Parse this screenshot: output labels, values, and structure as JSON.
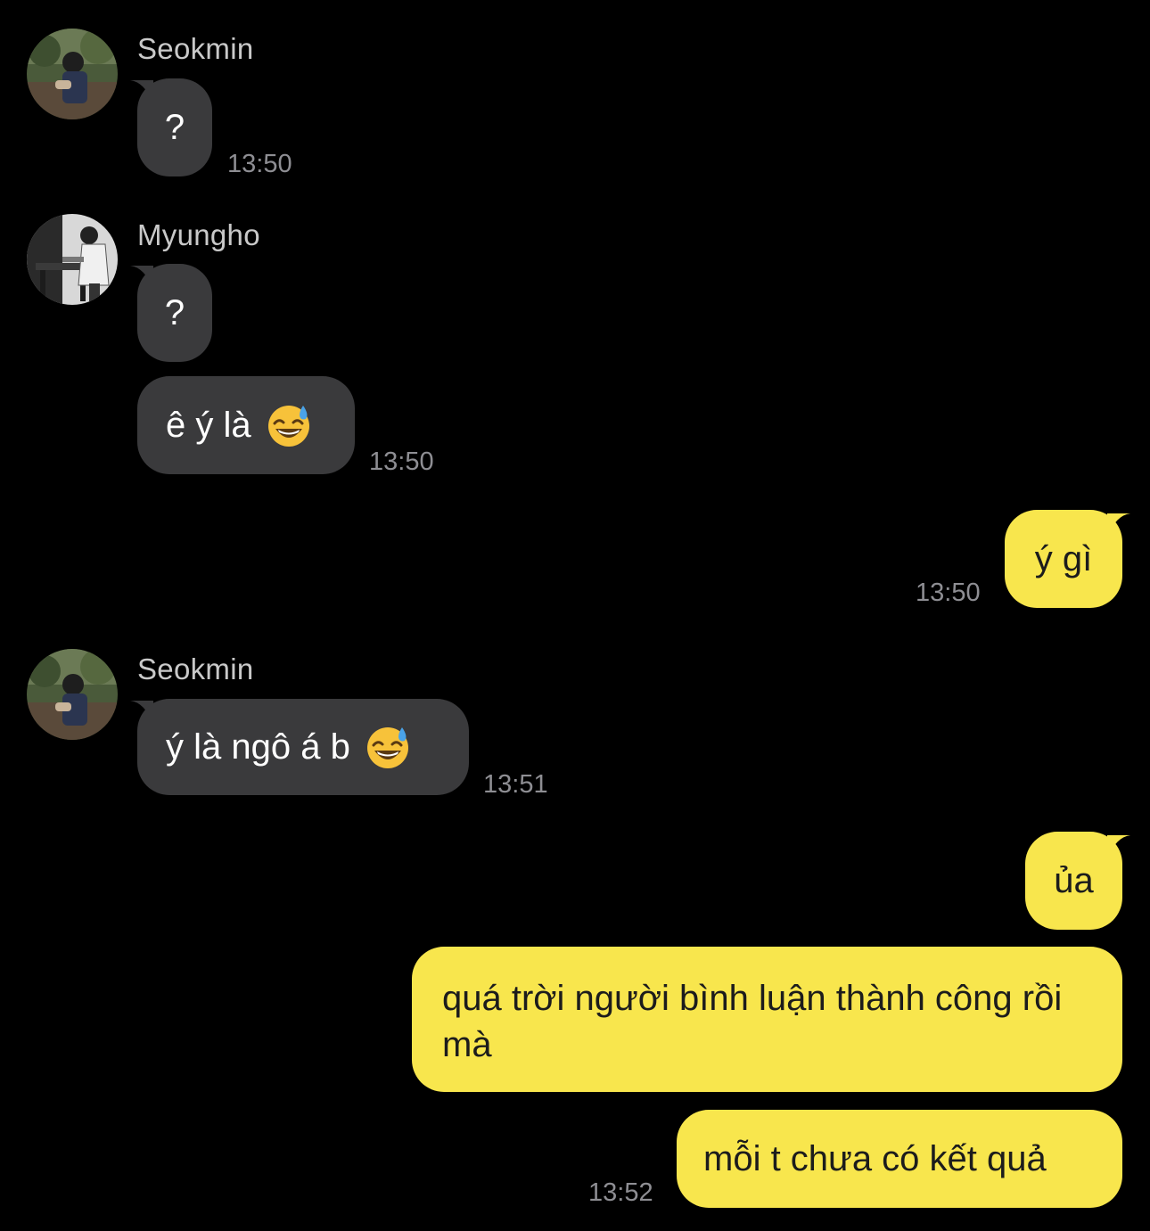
{
  "chat": {
    "groups": [
      {
        "sender": "Seokmin",
        "avatar_icon": "seokmin-avatar-photo",
        "messages": [
          {
            "text": "?",
            "time": "13:50"
          }
        ]
      },
      {
        "sender": "Myungho",
        "avatar_icon": "myungho-avatar-photo",
        "messages": [
          {
            "text": "?"
          },
          {
            "text": "ê ý là",
            "emoji": "grinning-sweat-emoji",
            "time": "13:50"
          }
        ]
      },
      {
        "sender": "me",
        "messages": [
          {
            "text": "ý gì",
            "time": "13:50"
          }
        ]
      },
      {
        "sender": "Seokmin",
        "avatar_icon": "seokmin-avatar-photo",
        "messages": [
          {
            "text": "ý là ngô á b",
            "emoji": "grinning-sweat-emoji",
            "time": "13:51"
          }
        ]
      },
      {
        "sender": "me",
        "messages": [
          {
            "text": "ủa"
          },
          {
            "text": "quá trời người bình luận thành công rồi mà"
          },
          {
            "text": "mỗi t chưa có kết quả",
            "time": "13:52"
          }
        ]
      }
    ]
  },
  "colors": {
    "background": "#000000",
    "incoming_bubble": "#3a3a3c",
    "outgoing_bubble": "#f8e64d",
    "sender_name": "#c9c9c9",
    "timestamp": "#8e8e93"
  }
}
